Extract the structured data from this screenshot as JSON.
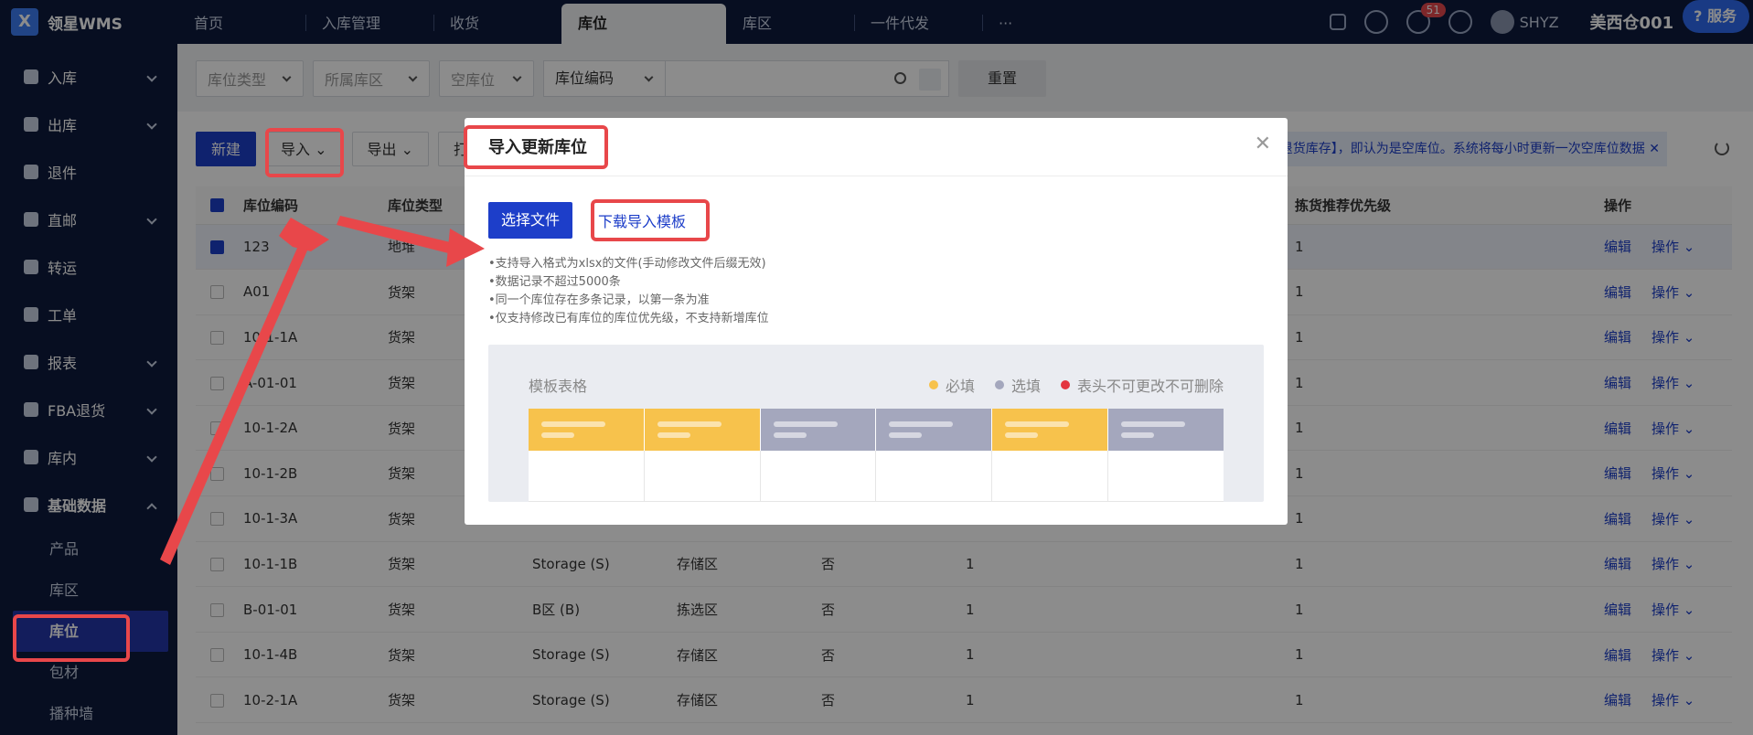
{
  "app": {
    "logo_text": "领星WMS"
  },
  "top_tabs": [
    {
      "label": "首页"
    },
    {
      "label": "入库管理"
    },
    {
      "label": "收货"
    },
    {
      "label": "库位"
    },
    {
      "label": "库区"
    },
    {
      "label": "一件代发"
    },
    {
      "label": "···"
    }
  ],
  "header": {
    "notification_count": "51",
    "user": "SHYZ",
    "warehouse": "美西仓001",
    "service_label": "服务"
  },
  "sidebar": {
    "items": [
      {
        "label": "入库"
      },
      {
        "label": "出库"
      },
      {
        "label": "退件"
      },
      {
        "label": "直邮"
      },
      {
        "label": "转运"
      },
      {
        "label": "工单"
      },
      {
        "label": "报表"
      },
      {
        "label": "FBA退货"
      },
      {
        "label": "库内"
      },
      {
        "label": "基础数据"
      }
    ],
    "sub_items": [
      {
        "label": "产品"
      },
      {
        "label": "库区"
      },
      {
        "label": "库位"
      },
      {
        "label": "包材"
      },
      {
        "label": "播种墙"
      }
    ]
  },
  "filters": {
    "location_type": "库位类型",
    "zone": "所属库区",
    "empty": "空库位",
    "code_field": "库位编码",
    "reset": "重置"
  },
  "toolbar": {
    "new": "新建",
    "import": "导入",
    "export": "导出",
    "print": "打"
  },
  "notice": "存+退货库存】，即认为是空库位。系统将每小时更新一次空库位数据",
  "table": {
    "headers": {
      "code": "库位编码",
      "type": "库位类型",
      "priority": "拣货推荐优先级",
      "action": "操作"
    },
    "rows": [
      {
        "code": "123",
        "type": "地堆",
        "zone": "",
        "area": "",
        "empty": "",
        "num": "",
        "priority": "1"
      },
      {
        "code": "A01",
        "type": "货架",
        "zone": "",
        "area": "",
        "empty": "",
        "num": "",
        "priority": "1"
      },
      {
        "code": "10-1-1A",
        "type": "货架",
        "zone": "",
        "area": "",
        "empty": "",
        "num": "",
        "priority": "1"
      },
      {
        "code": "A-01-01",
        "type": "货架",
        "zone": "",
        "area": "",
        "empty": "",
        "num": "",
        "priority": "1"
      },
      {
        "code": "10-1-2A",
        "type": "货架",
        "zone": "",
        "area": "",
        "empty": "",
        "num": "",
        "priority": "1"
      },
      {
        "code": "10-1-2B",
        "type": "货架",
        "zone": "",
        "area": "",
        "empty": "",
        "num": "",
        "priority": "1"
      },
      {
        "code": "10-1-3A",
        "type": "货架",
        "zone": "",
        "area": "",
        "empty": "",
        "num": "",
        "priority": "1"
      },
      {
        "code": "10-1-1B",
        "type": "货架",
        "zone": "Storage (S)",
        "area": "存储区",
        "empty": "否",
        "num": "1",
        "priority": "1"
      },
      {
        "code": "B-01-01",
        "type": "货架",
        "zone": "B区 (B)",
        "area": "拣选区",
        "empty": "否",
        "num": "1",
        "priority": "1"
      },
      {
        "code": "10-1-4B",
        "type": "货架",
        "zone": "Storage (S)",
        "area": "存储区",
        "empty": "否",
        "num": "1",
        "priority": "1"
      },
      {
        "code": "10-2-1A",
        "type": "货架",
        "zone": "Storage (S)",
        "area": "存储区",
        "empty": "否",
        "num": "1",
        "priority": "1"
      }
    ],
    "edit_label": "编辑",
    "ops_label": "操作"
  },
  "dialog": {
    "title": "导入更新库位",
    "choose_file": "选择文件",
    "download_template": "下载导入模板",
    "tips": [
      "•支持导入格式为xlsx的文件(手动修改文件后缀无效)",
      "•数据记录不超过5000条",
      "•同一个库位存在多条记录，以第一条为准",
      "•仅支持修改已有库位的库位优先级，不支持新增库位"
    ],
    "template_title": "模板表格",
    "legend": {
      "required": "必填",
      "optional": "选填",
      "locked": "表头不可更改不可删除"
    }
  },
  "colors": {
    "required": "#f7c24c",
    "optional": "#a4a7bd",
    "locked": "#e3343f",
    "accent": "#1d3ec9",
    "annotation": "#e8474a"
  }
}
